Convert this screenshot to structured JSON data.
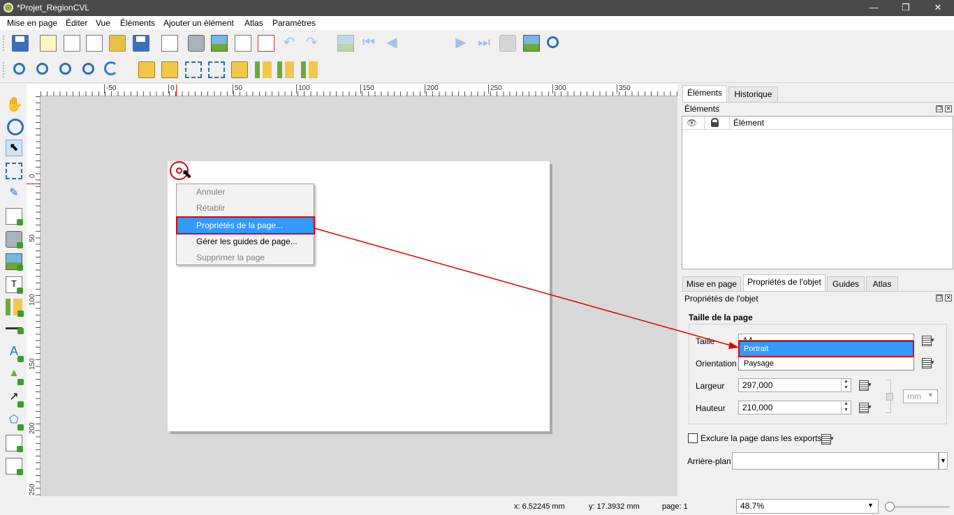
{
  "window": {
    "title": "*Projet_RegionCVL",
    "minimize": "—",
    "restore": "❐",
    "close": "✕"
  },
  "menu": [
    "Mise en page",
    "Éditer",
    "Vue",
    "Éléments",
    "Ajouter un élément",
    "Atlas",
    "Paramètres"
  ],
  "toolbar": {
    "page_number": "1"
  },
  "ruler": {
    "h_labels": [
      "-50",
      "0",
      "50",
      "100",
      "150",
      "200",
      "250",
      "300",
      "350"
    ],
    "v_labels": [
      "0",
      "50",
      "100",
      "150",
      "200",
      "250"
    ]
  },
  "context_menu": {
    "items": [
      "Annuler",
      "Rétablir",
      "Propriétés de la page...",
      "Gérer les guides de page...",
      "Supprimer la page"
    ]
  },
  "right_panel": {
    "top_tabs": [
      "Éléments",
      "Historique"
    ],
    "items_title": "Éléments",
    "items_header": "Élément",
    "bottom_tabs": [
      "Mise en page",
      "Propriétés de l'objet",
      "Guides",
      "Atlas"
    ],
    "props_title": "Propriétés de l'objet",
    "section_title": "Taille de la page",
    "size_label": "Taille",
    "size_value": "A4",
    "orientation_label": "Orientation",
    "orientation_options": [
      "Portrait",
      "Paysage"
    ],
    "width_label": "Largeur",
    "width_value": "297,000",
    "height_label": "Hauteur",
    "height_value": "210,000",
    "unit": "mm",
    "exclude_label": "Exclure la page dans les exports",
    "background_label": "Arrière-plan"
  },
  "status": {
    "x": "x: 6.52245 mm",
    "y": "y: 17.3932 mm",
    "page": "page: 1",
    "zoom": "48.7%"
  },
  "colors": {
    "highlight": "#3399ff",
    "annotation": "#e00000",
    "titlebar": "#4a4a4a"
  }
}
